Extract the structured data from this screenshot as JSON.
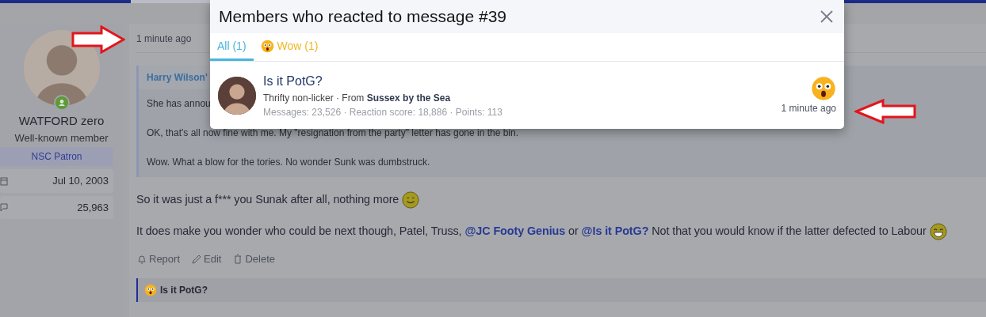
{
  "user": {
    "name": "WATFORD zero",
    "title": "Well-known member",
    "banner": "NSC Patron",
    "joined": "Jul 10, 2003",
    "messages": "25,963",
    "online": true
  },
  "post": {
    "time": "1 minute ago",
    "quote": {
      "author": "Harry Wilson'",
      "lines": [
        "She has annou",
        "OK, that's all now fine with me. My \"resignation from the party\" letter has gone in the bin.",
        "Wow. What a blow for the tories. No wonder Sunk was dumbstruck."
      ]
    },
    "paragraphs": [
      [
        {
          "kind": "text",
          "text": "So it was just a f*** you Sunak after all, nothing more"
        },
        {
          "kind": "smile"
        }
      ],
      [
        {
          "kind": "text",
          "text": "It does make you wonder who could be next though, Patel, Truss, "
        },
        {
          "kind": "mention",
          "text": "@JC Footy Genius"
        },
        {
          "kind": "text",
          "text": " or "
        },
        {
          "kind": "mention",
          "text": "@Is it PotG?"
        },
        {
          "kind": "text",
          "text": " Not that you would know if the latter defected to Labour"
        },
        {
          "kind": "laugh"
        }
      ]
    ],
    "actions": [
      {
        "kind": "report",
        "label": "Report"
      },
      {
        "kind": "edit",
        "label": "Edit"
      },
      {
        "kind": "delete",
        "label": "Delete"
      }
    ],
    "reactions": {
      "kind": "wow",
      "text": "Is it PotG?"
    }
  },
  "modal": {
    "title": "Members who reacted to message #39",
    "tabs": [
      {
        "label": "All (1)",
        "selected": true
      },
      {
        "label": "Wow (1)",
        "selected": false,
        "kind": "wow"
      }
    ],
    "members": [
      {
        "name": "Is it PotG?",
        "info": "Thrifty non-licker · From **Sussex by the Sea**",
        "stats": "Messages: 23,526 · Reaction score: 18,886 · Points: 113",
        "kind": "wow",
        "time": "1 minute ago"
      }
    ]
  }
}
